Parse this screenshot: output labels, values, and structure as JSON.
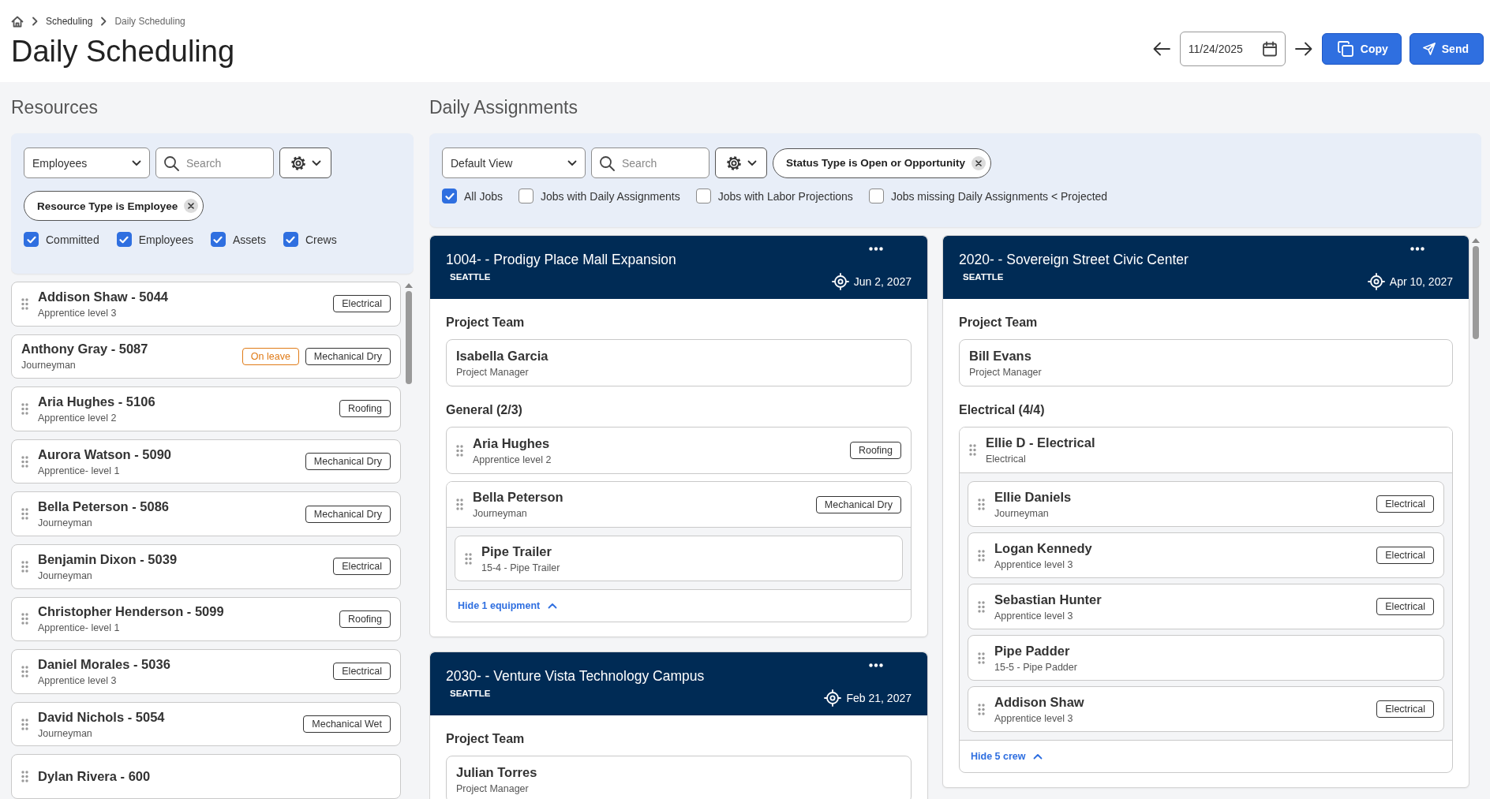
{
  "breadcrumb": [
    {
      "label": "Scheduling",
      "kind": "link"
    },
    {
      "label": "Daily Scheduling",
      "kind": "current"
    }
  ],
  "page_title": "Daily Scheduling",
  "date_nav": {
    "date": "11/24/2025"
  },
  "actions": [
    {
      "label": "Copy",
      "kind": "copy"
    },
    {
      "label": "Send",
      "kind": "send"
    }
  ],
  "resources": {
    "heading": "Resources",
    "type_dropdown": "Employees",
    "search": {
      "placeholder": "Search"
    },
    "filter_chip": "Resource Type is Employee",
    "checkboxes": [
      {
        "label": "Committed",
        "checked": true
      },
      {
        "label": "Employees",
        "checked": true
      },
      {
        "label": "Assets",
        "checked": true
      },
      {
        "label": "Crews",
        "checked": true
      }
    ],
    "items": [
      {
        "name": "Addison Shaw - 5044",
        "role": "Apprentice level 3",
        "draggable": true,
        "tags": [
          {
            "label": "Electrical",
            "kind": "trade"
          }
        ]
      },
      {
        "name": "Anthony Gray - 5087",
        "role": "Journeyman",
        "draggable": false,
        "tags": [
          {
            "label": "On leave",
            "kind": "leave"
          },
          {
            "label": "Mechanical Dry",
            "kind": "trade"
          }
        ]
      },
      {
        "name": "Aria Hughes - 5106",
        "role": "Apprentice level 2",
        "draggable": true,
        "tags": [
          {
            "label": "Roofing",
            "kind": "trade"
          }
        ]
      },
      {
        "name": "Aurora Watson - 5090",
        "role": "Apprentice- level 1",
        "draggable": true,
        "tags": [
          {
            "label": "Mechanical Dry",
            "kind": "trade"
          }
        ]
      },
      {
        "name": "Bella Peterson - 5086",
        "role": "Journeyman",
        "draggable": true,
        "tags": [
          {
            "label": "Mechanical Dry",
            "kind": "trade"
          }
        ]
      },
      {
        "name": "Benjamin Dixon - 5039",
        "role": "Journeyman",
        "draggable": true,
        "tags": [
          {
            "label": "Electrical",
            "kind": "trade"
          }
        ]
      },
      {
        "name": "Christopher Henderson - 5099",
        "role": "Apprentice- level 1",
        "draggable": true,
        "tags": [
          {
            "label": "Roofing",
            "kind": "trade"
          }
        ]
      },
      {
        "name": "Daniel Morales - 5036",
        "role": "Apprentice level 3",
        "draggable": true,
        "tags": [
          {
            "label": "Electrical",
            "kind": "trade"
          }
        ]
      },
      {
        "name": "David Nichols - 5054",
        "role": "Journeyman",
        "draggable": true,
        "tags": [
          {
            "label": "Mechanical Wet",
            "kind": "trade"
          }
        ]
      },
      {
        "name": "Dylan Rivera - 600",
        "draggable": true
      }
    ]
  },
  "assignments": {
    "heading": "Daily Assignments",
    "view_dropdown": "Default View",
    "search": {
      "placeholder": "Search"
    },
    "filter_chip": "Status Type is Open or Opportunity",
    "checkboxes": [
      {
        "label": "All Jobs",
        "checked": true
      },
      {
        "label": "Jobs with Daily Assignments",
        "checked": false
      },
      {
        "label": "Jobs with Labor Projections",
        "checked": false
      },
      {
        "label": "Jobs missing Daily Assignments < Projected",
        "checked": false
      }
    ],
    "columns": [
      {
        "jobs": [
          {
            "title": "1004- - Prodigy Place Mall Expansion",
            "location": "SEATTLE",
            "date": "Jun 2, 2027",
            "sections": [
              {
                "title": "Project Team",
                "kind": "team",
                "members": [
                  {
                    "name": "Isabella Garcia",
                    "role": "Project Manager"
                  }
                ]
              },
              {
                "title": "General (2/3)",
                "kind": "crew",
                "members": [
                  {
                    "name": "Aria Hughes",
                    "role": "Apprentice level 2",
                    "tag": "Roofing"
                  },
                  {
                    "name": "Bella Peterson",
                    "role": "Journeyman",
                    "tag": "Mechanical Dry",
                    "toggle": "Hide 1 equipment",
                    "expanded": true,
                    "children": [
                      {
                        "name": "Pipe Trailer",
                        "role": "15-4 - Pipe Trailer"
                      }
                    ]
                  }
                ]
              }
            ]
          },
          {
            "title": "2030- - Venture Vista Technology Campus",
            "location": "SEATTLE",
            "date": "Feb 21, 2027",
            "sections": [
              {
                "title": "Project Team",
                "kind": "team",
                "members": [
                  {
                    "name": "Julian Torres",
                    "role": "Project Manager"
                  }
                ]
              }
            ]
          }
        ]
      },
      {
        "jobs": [
          {
            "title": "2020- - Sovereign Street Civic Center",
            "location": "SEATTLE",
            "date": "Apr 10, 2027",
            "sections": [
              {
                "title": "Project Team",
                "kind": "team",
                "members": [
                  {
                    "name": "Bill Evans",
                    "role": "Project Manager"
                  }
                ]
              },
              {
                "title": "Electrical (4/4)",
                "kind": "crew",
                "members": [
                  {
                    "name": "Ellie D - Electrical",
                    "role": "Electrical",
                    "toggle": "Hide 5 crew",
                    "expanded": true,
                    "children": [
                      {
                        "name": "Ellie Daniels",
                        "role": "Journeyman",
                        "tag": "Electrical"
                      },
                      {
                        "name": "Logan Kennedy",
                        "role": "Apprentice level 3",
                        "tag": "Electrical"
                      },
                      {
                        "name": "Sebastian Hunter",
                        "role": "Apprentice level 3",
                        "tag": "Electrical"
                      },
                      {
                        "name": "Pipe Padder",
                        "role": "15-5 - Pipe Padder"
                      },
                      {
                        "name": "Addison Shaw",
                        "role": "Apprentice level 3",
                        "tag": "Electrical"
                      }
                    ]
                  }
                ]
              }
            ]
          }
        ]
      }
    ]
  }
}
